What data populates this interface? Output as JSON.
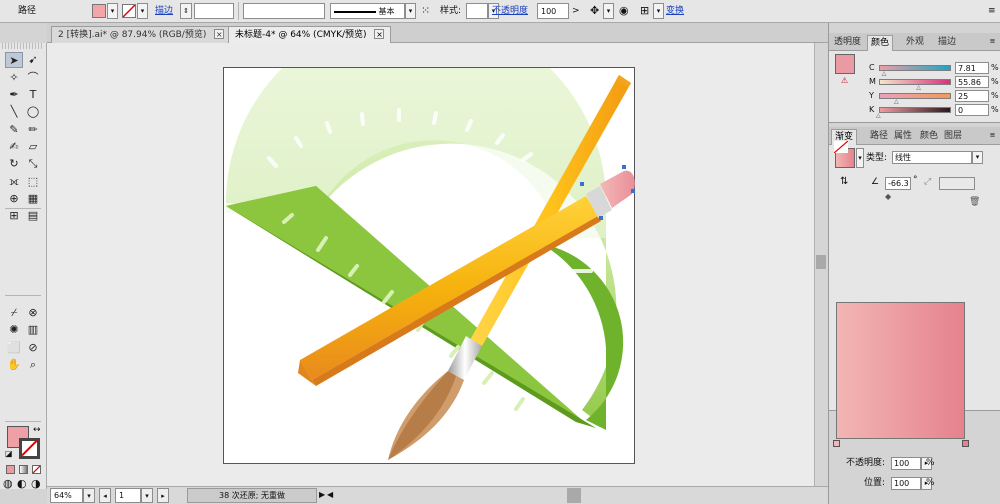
{
  "control_bar": {
    "object_type": "路径",
    "stroke_link": "描边",
    "stroke_weight_value": "",
    "stroke_profile_value": "",
    "brush_label": "基本",
    "style_label": "样式:",
    "opacity_link": "不透明度",
    "opacity_value": "100",
    "opacity_unit": ">",
    "transform_link": "变换",
    "fill_color": "#f3a5a9"
  },
  "doc_tabs": [
    {
      "label": "2 [转换].ai* @ 87.94% (RGB/预览)",
      "close": "×"
    },
    {
      "label": "未标题-4* @ 64% (CMYK/预览)",
      "close": "×"
    }
  ],
  "toolbox": {
    "tools": [
      "selection-icon",
      "direct-selection-icon",
      "magic-wand-icon",
      "lasso-icon",
      "pen-icon",
      "type-icon",
      "line-icon",
      "ellipse-icon",
      "paintbrush-icon",
      "pencil-icon",
      "blob-brush-icon",
      "eraser-icon",
      "rotate-icon",
      "scale-icon",
      "width-icon",
      "free-transform-icon",
      "shape-builder-icon",
      "perspective-icon",
      "mesh-icon",
      "gradient-icon",
      "eyedropper-icon",
      "blend-icon",
      "symbol-sprayer-icon",
      "column-graph-icon",
      "artboard-icon",
      "slice-icon",
      "hand-icon",
      "zoom-icon"
    ],
    "fill_color": "#efa0a6"
  },
  "status_bar": {
    "zoom": "64%",
    "page": "1",
    "status_text": "38 次还原; 无重做",
    "play": "▶",
    "back": "◀"
  },
  "color_panel": {
    "tabs": [
      "透明度",
      "颜色",
      "外观",
      "描边"
    ],
    "active_tab": "颜色",
    "swatch_color": "#e99aa2",
    "channels": [
      {
        "letter": "C",
        "value": "7.81",
        "unit": "%",
        "level": 0.0781,
        "track": "linear-gradient(90deg,#f09ca3,#1aa6c8)"
      },
      {
        "letter": "M",
        "value": "55.86",
        "unit": "%",
        "level": 0.5586,
        "track": "linear-gradient(90deg,#f3e7c9,#d9307b)"
      },
      {
        "letter": "Y",
        "value": "25",
        "unit": "%",
        "level": 0.25,
        "track": "linear-gradient(90deg,#e9a0bd,#f39a58)"
      },
      {
        "letter": "K",
        "value": "0",
        "unit": "%",
        "level": 0.0,
        "track": "linear-gradient(90deg,#ef9ca3,#2a1a1c)"
      }
    ]
  },
  "gradient_panel": {
    "tabs": [
      "渐变",
      "路径",
      "属性",
      "颜色",
      "图层"
    ],
    "active_tab": "渐变",
    "type_label": "类型:",
    "type_value": "线性",
    "angle_value": "-66.3",
    "angle_unit": "°",
    "start_color": "#f2b6b4",
    "end_color": "#e6828d",
    "opacity_label": "不透明度:",
    "opacity_value": "100",
    "position_label": "位置:",
    "position_value": "100",
    "unit": "%"
  }
}
